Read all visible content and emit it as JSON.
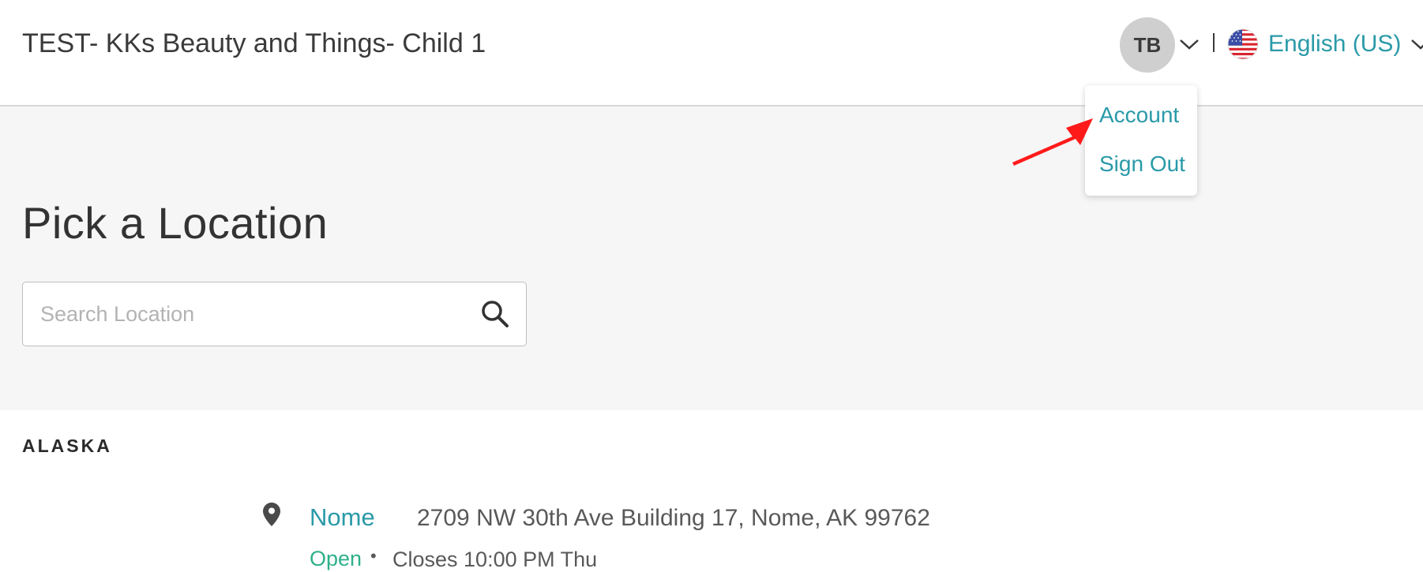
{
  "header": {
    "business_name": "TEST- KKs Beauty and Things- Child 1",
    "user_initials": "TB",
    "language": "English (US)"
  },
  "user_menu": {
    "items": [
      {
        "label": "Account"
      },
      {
        "label": "Sign Out"
      }
    ]
  },
  "main": {
    "title": "Pick a Location",
    "search": {
      "placeholder": "Search Location",
      "value": ""
    }
  },
  "locations": {
    "region": "ALASKA",
    "items": [
      {
        "name": "Nome",
        "address": "2709 NW 30th Ave Building 17, Nome, AK 99762",
        "status": "Open",
        "separator": "•",
        "hours": "Closes 10:00 PM Thu"
      }
    ]
  },
  "colors": {
    "accent": "#2a9aa8",
    "open_status": "#2eb08a",
    "hero_background": "#f6f6f6",
    "annotation_arrow": "#ff1a1a"
  },
  "icons": [
    "chevron-down-icon",
    "us-flag-icon",
    "search-icon",
    "location-pin-icon",
    "arrow-annotation-icon"
  ]
}
